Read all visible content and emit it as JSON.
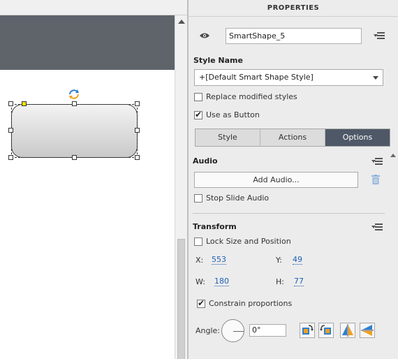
{
  "panel": {
    "title": "PROPERTIES"
  },
  "object": {
    "name": "SmartShape_5"
  },
  "style": {
    "section_label": "Style Name",
    "selected": "+[Default Smart Shape Style]",
    "replace_modified_label": "Replace modified styles",
    "replace_modified_checked": false,
    "use_as_button_label": "Use as Button",
    "use_as_button_checked": true
  },
  "tabs": [
    {
      "label": "Style",
      "active": false
    },
    {
      "label": "Actions",
      "active": false
    },
    {
      "label": "Options",
      "active": true
    }
  ],
  "audio": {
    "section_label": "Audio",
    "add_button": "Add Audio...",
    "stop_slide_audio_label": "Stop Slide Audio",
    "stop_slide_audio_checked": false
  },
  "transform": {
    "section_label": "Transform",
    "lock_label": "Lock Size and Position",
    "lock_checked": false,
    "x_label": "X:",
    "x_value": "553",
    "y_label": "Y:",
    "y_value": "49",
    "w_label": "W:",
    "w_value": "180",
    "h_label": "H:",
    "h_value": "77",
    "constrain_label": "Constrain proportions",
    "constrain_checked": true,
    "angle_label": "Angle:",
    "angle_value": "0°"
  },
  "icons": {
    "visibility": "eye-icon",
    "panel_menu": "panel-menu-icon",
    "delete_audio": "trash-icon",
    "rotate": "rotate-icon",
    "tools": [
      "rotate-clockwise-icon",
      "rotate-counterclockwise-icon",
      "flip-horizontal-icon",
      "flip-vertical-icon"
    ]
  },
  "colors": {
    "active_tab": "#4e5867",
    "link_value": "#1f5fb4",
    "slide_band": "#5f646b",
    "tool_blue": "#2f7fd2",
    "tool_orange": "#f0a020"
  }
}
